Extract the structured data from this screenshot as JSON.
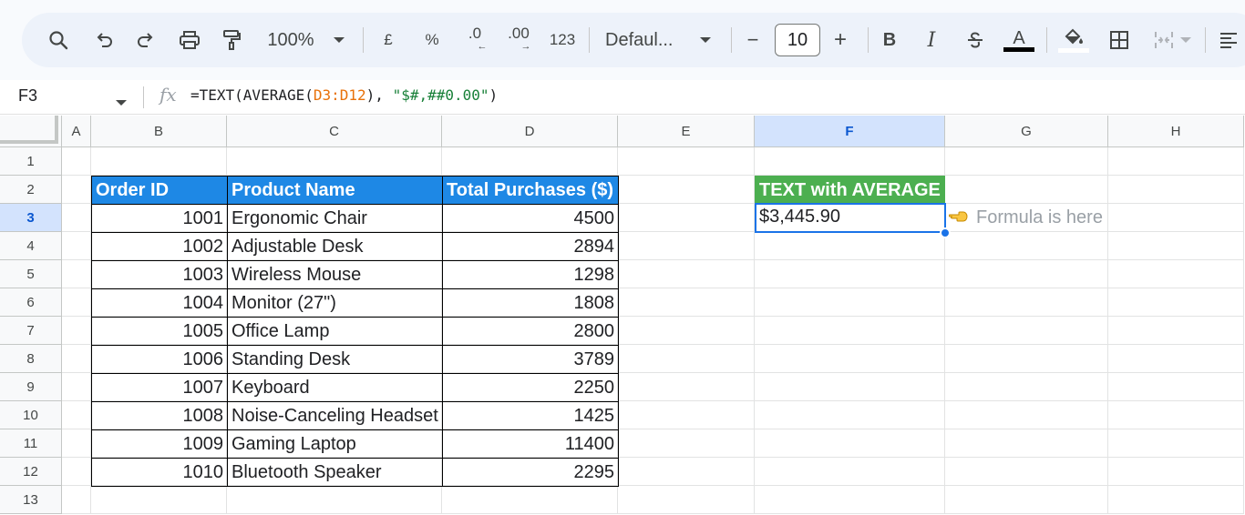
{
  "toolbar": {
    "zoom": "100%",
    "currency": "£",
    "percent": "%",
    "decrease_decimals": ".0",
    "increase_decimals": ".00",
    "number_format": "123",
    "font": "Defaul...",
    "font_size": "10",
    "minus": "−",
    "plus": "+",
    "bold": "B",
    "italic": "I",
    "text_color_letter": "A"
  },
  "formula_bar": {
    "cell_ref": "F3",
    "fx": "fx",
    "formula_prefix": "=TEXT(AVERAGE(",
    "formula_ref": "D3:D12",
    "formula_mid": "), ",
    "formula_string": "\"$#,##0.00\"",
    "formula_suffix": ")"
  },
  "columns": [
    "A",
    "B",
    "C",
    "D",
    "E",
    "F",
    "G",
    "H"
  ],
  "selected_column": "F",
  "rows": [
    "1",
    "2",
    "3",
    "4",
    "5",
    "6",
    "7",
    "8",
    "9",
    "10",
    "11",
    "12",
    "13"
  ],
  "selected_row": "3",
  "table": {
    "headers": [
      "Order ID",
      "Product Name",
      "Total Purchases ($)"
    ],
    "rows": [
      [
        "1001",
        "Ergonomic Chair",
        "4500"
      ],
      [
        "1002",
        "Adjustable Desk",
        "2894"
      ],
      [
        "1003",
        "Wireless Mouse",
        "1298"
      ],
      [
        "1004",
        "Monitor (27\")",
        "1808"
      ],
      [
        "1005",
        "Office Lamp",
        "2800"
      ],
      [
        "1006",
        "Standing Desk",
        "3789"
      ],
      [
        "1007",
        "Keyboard",
        "2250"
      ],
      [
        "1008",
        "Noise-Canceling Headset",
        "1425"
      ],
      [
        "1009",
        "Gaming Laptop",
        "11400"
      ],
      [
        "1010",
        "Bluetooth Speaker",
        "2295"
      ]
    ]
  },
  "result": {
    "header": "TEXT with AVERAGE",
    "value": "$3,445.90",
    "note": "Formula is here",
    "note_icon": "pointing-hand-icon"
  },
  "colors": {
    "table_header": "#1e88e5",
    "result_header": "#4caf50",
    "selection": "#1a73e8"
  }
}
